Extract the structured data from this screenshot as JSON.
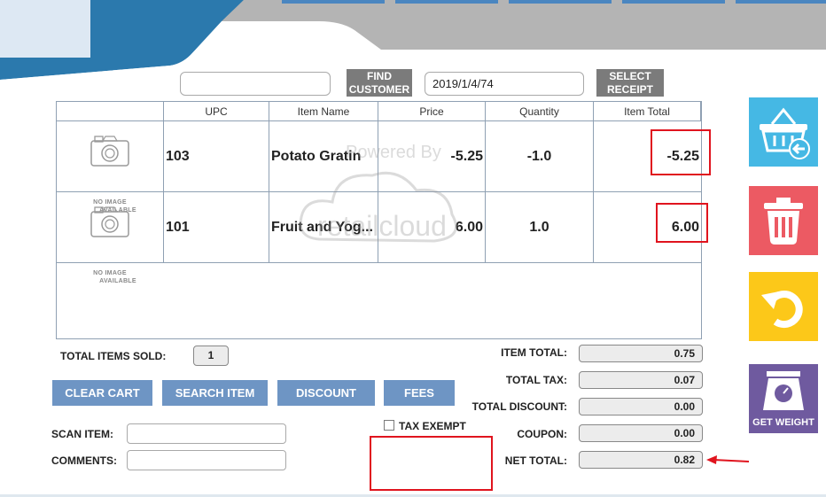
{
  "header": {
    "colors": {
      "dark_blue": "#2b79ad",
      "light_blue": "#dde8f3",
      "gray": "#b4b4b4"
    }
  },
  "toolbar": {
    "customer_input_value": "",
    "find_customer_line1": "FIND",
    "find_customer_line2": "CUSTOMER",
    "receipt_input_value": "2019/1/4/74",
    "select_receipt_line1": "SELECT",
    "select_receipt_line2": "RECEIPT"
  },
  "table": {
    "columns": [
      "",
      "UPC",
      "Item Name",
      "Price",
      "Quantity",
      "Item Total"
    ],
    "no_image_line1": "NO IMAGE",
    "no_image_line2": "AVAILABLE",
    "rows": [
      {
        "upc": "103",
        "name": "Potato Gratin",
        "price": "-5.25",
        "quantity": "-1.0",
        "total": "-5.25"
      },
      {
        "upc": "101",
        "name": "Fruit and Yog...",
        "price": "6.00",
        "quantity": "1.0",
        "total": "6.00"
      }
    ]
  },
  "watermark": {
    "line1": "Powered By",
    "line2": "retailcloud"
  },
  "summary": {
    "total_items_label": "TOTAL ITEMS SOLD:",
    "total_items_value": "1"
  },
  "actions": {
    "clear_cart": "CLEAR CART",
    "search_item": "SEARCH ITEM",
    "discount": "DISCOUNT",
    "fees": "FEES"
  },
  "fields": {
    "scan_item_label": "SCAN ITEM:",
    "scan_item_value": "",
    "comments_label": "COMMENTS:",
    "comments_value": "",
    "tax_exempt_label": "TAX EXEMPT"
  },
  "totals": {
    "item_total_label": "ITEM TOTAL:",
    "item_total_value": "0.75",
    "total_tax_label": "TOTAL TAX:",
    "total_tax_value": "0.07",
    "total_discount_label": "TOTAL DISCOUNT:",
    "total_discount_value": "0.00",
    "coupon_label": "COUPON:",
    "coupon_value": "0.00",
    "net_total_label": "NET TOTAL:",
    "net_total_value": "0.82"
  },
  "sidebar": {
    "return_cart_icon": "basket-return-icon",
    "delete_icon": "trash-icon",
    "undo_icon": "undo-icon",
    "get_weight_icon": "scale-icon",
    "get_weight_label": "GET WEIGHT",
    "colors": {
      "blue": "#45b8e4",
      "red": "#ec5a63",
      "yellow": "#fcc819",
      "purple": "#6f5a9f"
    }
  },
  "annotation_color": "#e0141e"
}
